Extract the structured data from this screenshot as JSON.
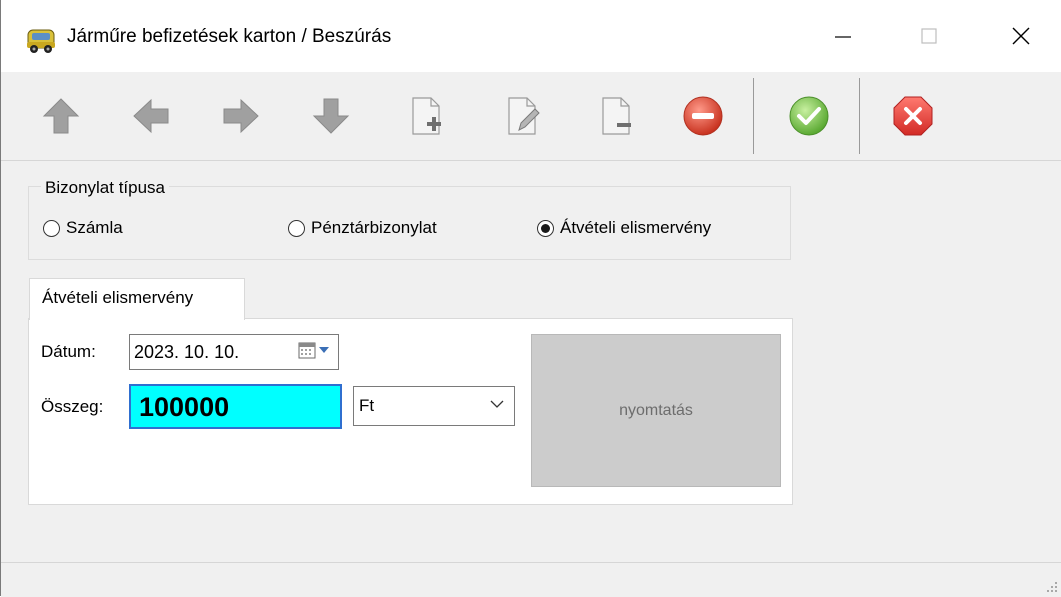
{
  "window": {
    "title": "Járműre befizetések karton / Beszúrás",
    "app_icon": "car-icon"
  },
  "toolbar": {
    "buttons": [
      {
        "name": "first-record-button",
        "icon": "arrow-up-icon"
      },
      {
        "name": "previous-record-button",
        "icon": "arrow-left-icon"
      },
      {
        "name": "next-record-button",
        "icon": "arrow-right-icon"
      },
      {
        "name": "last-record-button",
        "icon": "arrow-down-icon"
      },
      {
        "name": "new-record-button",
        "icon": "document-add-icon"
      },
      {
        "name": "edit-record-button",
        "icon": "document-edit-icon"
      },
      {
        "name": "remove-record-button",
        "icon": "document-remove-icon"
      },
      {
        "name": "delete-button",
        "icon": "red-minus-icon"
      },
      {
        "name": "confirm-button",
        "icon": "green-check-icon"
      },
      {
        "name": "cancel-button",
        "icon": "red-x-icon"
      }
    ]
  },
  "document_type": {
    "group_label": "Bizonylat típusa",
    "options": [
      "Számla",
      "Pénztárbizonylat",
      "Átvételi elismervény"
    ],
    "selected": "Átvételi elismervény"
  },
  "tab": {
    "label": "Átvételi elismervény"
  },
  "form": {
    "date_label": "Dátum:",
    "date_value": "2023. 10. 10.",
    "amount_label": "Összeg:",
    "amount_value": "100000",
    "currency_value": "Ft",
    "print_label": "nyomtatás"
  },
  "colors": {
    "amount_bg": "#00ffff",
    "amount_border": "#2f6fd0",
    "print_button_bg": "#cccccc",
    "confirm_green": "#6cc24a",
    "cancel_red": "#e0393e"
  }
}
